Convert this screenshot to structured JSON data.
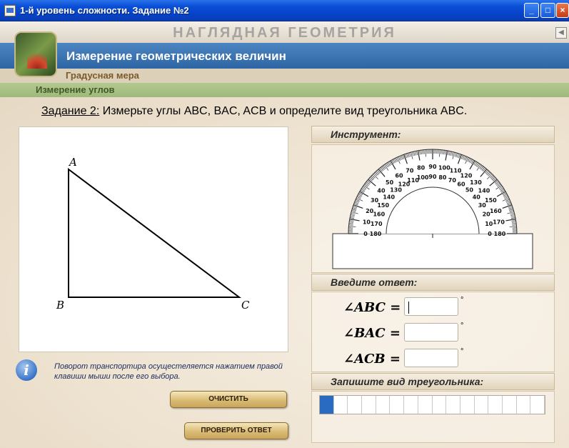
{
  "window": {
    "title": "1-й уровень сложности. Задание №2",
    "buttons": {
      "minimize": "_",
      "maximize": "□",
      "close": "×"
    }
  },
  "header": {
    "brand": "НАГЛЯДНАЯ ГЕОМЕТРИЯ",
    "section": "Измерение геометрических величин",
    "subsection": "Градусная мера",
    "topic": "Измерение углов"
  },
  "task": {
    "label": "Задание 2:",
    "text": " Измерьте углы ABC, BAC, ACB и определите вид треугольника ABC."
  },
  "figure": {
    "vertices": {
      "a": "A",
      "b": "B",
      "c": "C"
    }
  },
  "hint": "Поворот транспортира осущестеляется нажатием правой клавиши мыши после его выбора.",
  "buttons": {
    "clear": "ОЧИСТИТЬ",
    "check": "ПРОВЕРИТЬ ОТВЕТ"
  },
  "panels": {
    "instrument": "Инструмент:",
    "answer": "Введите ответ:",
    "triangle_type": "Запишите вид треугольника:"
  },
  "answers": [
    {
      "label": "∠ABC =",
      "value": "",
      "unit": "°"
    },
    {
      "label": "∠BAC =",
      "value": "",
      "unit": "°"
    },
    {
      "label": "∠ACB =",
      "value": "",
      "unit": "°"
    }
  ],
  "triangle_type_field": {
    "cells": 16,
    "filled": 1,
    "fill_color": "#2a6bc2"
  }
}
